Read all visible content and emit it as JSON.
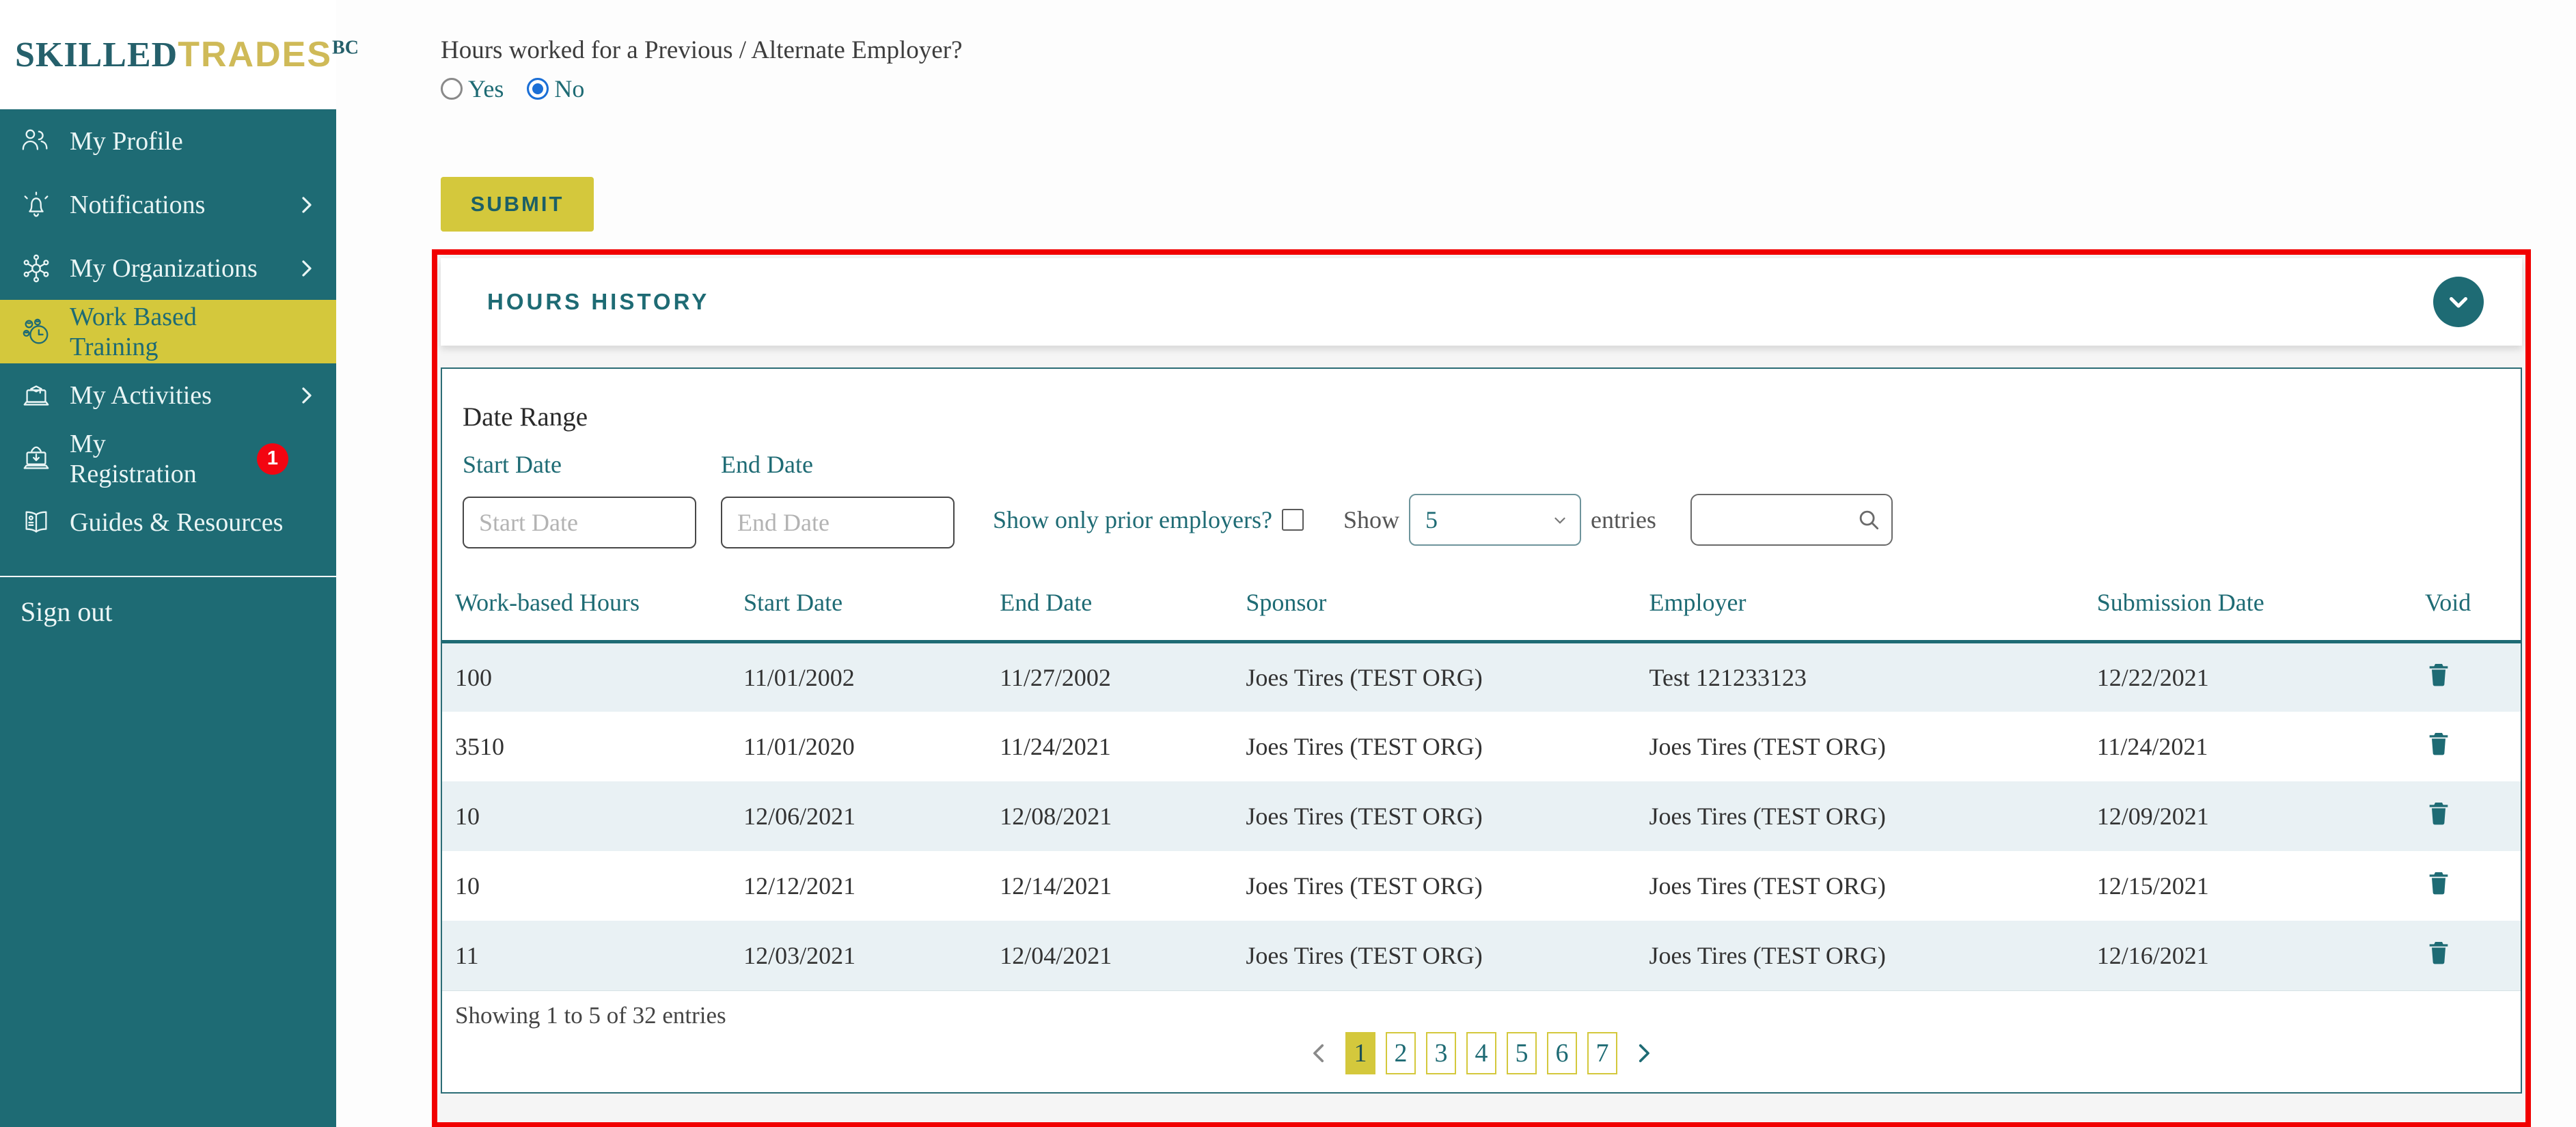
{
  "brand": {
    "name_primary": "SKILLED",
    "name_secondary": "TRADES",
    "name_suffix": "BC"
  },
  "colors": {
    "teal": "#1e6b74",
    "yellow": "#d4c83c",
    "red_border": "#f10000",
    "badge_red": "#f30511",
    "row_alt": "#e9f1f4",
    "radio_selected": "#1b6fd6"
  },
  "sidebar": {
    "items": [
      {
        "label": "My Profile",
        "icon": "person-icon",
        "chevron": false,
        "active": false,
        "badge": null
      },
      {
        "label": "Notifications",
        "icon": "bell-icon",
        "chevron": true,
        "active": false,
        "badge": null
      },
      {
        "label": "My Organizations",
        "icon": "network-icon",
        "chevron": true,
        "active": false,
        "badge": null
      },
      {
        "label": "Work Based Training",
        "icon": "coins-clock-icon",
        "chevron": false,
        "active": true,
        "badge": null
      },
      {
        "label": "My Activities",
        "icon": "laptop-grad-icon",
        "chevron": true,
        "active": false,
        "badge": null
      },
      {
        "label": "My Registration",
        "icon": "laptop-download-icon",
        "chevron": false,
        "active": false,
        "badge": "1"
      },
      {
        "label": "Guides & Resources",
        "icon": "book-icon",
        "chevron": false,
        "active": false,
        "badge": null
      }
    ],
    "sign_out": "Sign out"
  },
  "question": {
    "label": "Hours worked for a Previous / Alternate Employer?",
    "options": [
      {
        "label": "Yes",
        "selected": false
      },
      {
        "label": "No",
        "selected": true
      }
    ]
  },
  "submit_label": "SUBMIT",
  "hours_history": {
    "title": "HOURS HISTORY",
    "filters": {
      "date_range_label": "Date Range",
      "start_date_label": "Start Date",
      "start_date_placeholder": "Start Date",
      "start_date_value": "",
      "end_date_label": "End Date",
      "end_date_placeholder": "End Date",
      "end_date_value": "",
      "prior_employers_label": "Show only prior employers?",
      "prior_employers_checked": false,
      "show_label": "Show",
      "entries_per_page": "5",
      "entries_label": "entries",
      "search_value": ""
    },
    "table": {
      "columns": [
        "Work-based Hours",
        "Start Date",
        "End Date",
        "Sponsor",
        "Employer",
        "Submission Date",
        "Void"
      ],
      "rows": [
        {
          "hours": "100",
          "start_date": "11/01/2002",
          "end_date": "11/27/2002",
          "sponsor": "Joes Tires (TEST ORG)",
          "employer": "Test 121233123",
          "submission_date": "12/22/2021"
        },
        {
          "hours": "3510",
          "start_date": "11/01/2020",
          "end_date": "11/24/2021",
          "sponsor": "Joes Tires (TEST ORG)",
          "employer": "Joes Tires (TEST ORG)",
          "submission_date": "11/24/2021"
        },
        {
          "hours": "10",
          "start_date": "12/06/2021",
          "end_date": "12/08/2021",
          "sponsor": "Joes Tires (TEST ORG)",
          "employer": "Joes Tires (TEST ORG)",
          "submission_date": "12/09/2021"
        },
        {
          "hours": "10",
          "start_date": "12/12/2021",
          "end_date": "12/14/2021",
          "sponsor": "Joes Tires (TEST ORG)",
          "employer": "Joes Tires (TEST ORG)",
          "submission_date": "12/15/2021"
        },
        {
          "hours": "11",
          "start_date": "12/03/2021",
          "end_date": "12/04/2021",
          "sponsor": "Joes Tires (TEST ORG)",
          "employer": "Joes Tires (TEST ORG)",
          "submission_date": "12/16/2021"
        }
      ]
    },
    "footer": {
      "summary": "Showing 1 to 5 of 32 entries",
      "pages": [
        "1",
        "2",
        "3",
        "4",
        "5",
        "6",
        "7"
      ],
      "active_page": "1"
    }
  }
}
